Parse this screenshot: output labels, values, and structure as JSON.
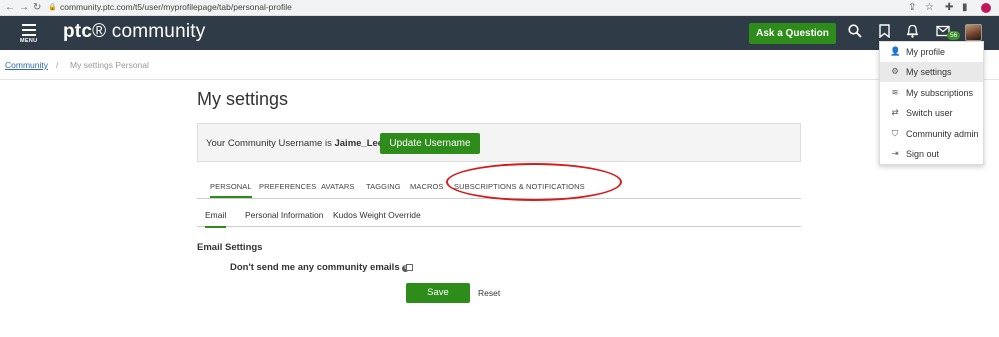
{
  "browser": {
    "back": "←",
    "forward": "→",
    "reload": "↻",
    "lock": "🔒",
    "url": "community.ptc.com/t5/user/myprofilepage/tab/personal-profile",
    "share": "⇪",
    "star": "☆",
    "puzzle": "✚",
    "sidepanel": "▮",
    "profile_color": "#c2185b"
  },
  "header": {
    "menu_label": "MENU",
    "logo_ptc": "ptc",
    "logo_rest": "® community",
    "ask_button": "Ask a Question",
    "notifications_badge": "56"
  },
  "breadcrumb": {
    "root": "Community",
    "separator": "/",
    "current": "My settings  Personal"
  },
  "page": {
    "title": "My settings",
    "username_prefix": "Your Community Username is ",
    "username": "Jaime_Lee",
    "update_button": "Update Username"
  },
  "tabs": [
    {
      "label": "PERSONAL",
      "active": true
    },
    {
      "label": "PREFERENCES",
      "active": false
    },
    {
      "label": "AVATARS",
      "active": false
    },
    {
      "label": "TAGGING",
      "active": false
    },
    {
      "label": "MACROS",
      "active": false
    },
    {
      "label": "SUBSCRIPTIONS & NOTIFICATIONS",
      "active": false
    }
  ],
  "subtabs": [
    {
      "label": "Email",
      "active": true
    },
    {
      "label": "Personal Information",
      "active": false
    },
    {
      "label": "Kudos Weight Override",
      "active": false
    }
  ],
  "email_settings": {
    "heading": "Email Settings",
    "option_label": "Don't send me any community emails",
    "info_icon": "i",
    "checked": false,
    "save_button": "Save",
    "reset_link": "Reset"
  },
  "user_menu": [
    {
      "icon": "👤",
      "label": "My profile"
    },
    {
      "icon": "⚙",
      "label": "My settings",
      "hover": true
    },
    {
      "icon": "≋",
      "label": "My subscriptions"
    },
    {
      "icon": "⇄",
      "label": "Switch user"
    },
    {
      "icon": "⛉",
      "label": "Community admin"
    },
    {
      "icon": "⇥",
      "label": "Sign out"
    }
  ],
  "colors": {
    "header_bg": "#2f3b46",
    "accent_green": "#2e8c1a",
    "annotation_red": "#d61b1b",
    "link_blue": "#2a6ab1"
  }
}
